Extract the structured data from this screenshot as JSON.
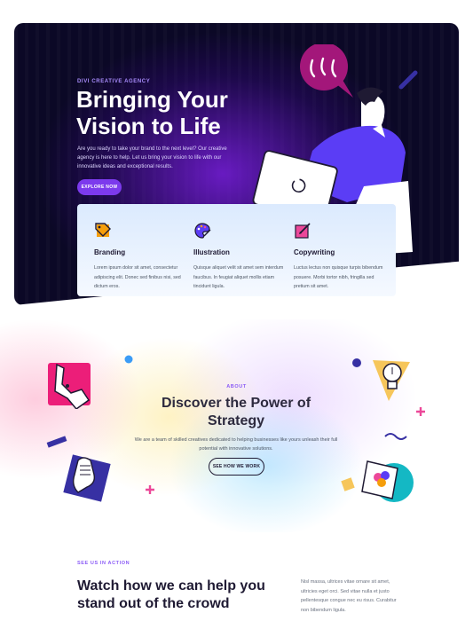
{
  "hero": {
    "eyebrow": "DIVI CREATIVE AGENCY",
    "title": "Bringing Your Vision to Life",
    "description": "Are you ready to take your brand to the next level? Our creative agency is here to help. Let us bring your vision to life with our innovative ideas and exceptional results.",
    "button_label": "EXPLORE NOW"
  },
  "features": [
    {
      "icon": "branding-tag-icon",
      "title": "Branding",
      "text": "Lorem ipsum dolor sit amet, consectetur adipiscing elit. Donec sed finibus nisi, sed dictum eros."
    },
    {
      "icon": "palette-icon",
      "title": "Illustration",
      "text": "Quisque aliquet velit sit amet sem interdum faucibus. In feugiat aliquet mollis etiam tincidunt ligula."
    },
    {
      "icon": "edit-pen-icon",
      "title": "Copywriting",
      "text": "Luctus lectus non quisque turpis bibendum posuere. Morbi tortor nibh, fringilla sed pretium sit amet."
    }
  ],
  "about": {
    "eyebrow": "ABOUT",
    "title": "Discover the Power of Strategy",
    "description": "We are a team of skilled creatives dedicated to helping businesses like yours unleash their full potential with innovative solutions.",
    "button_label": "SEE HOW WE WORK"
  },
  "action": {
    "eyebrow": "SEE US IN ACTION",
    "title": "Watch how we can help you stand out of the crowd",
    "text": "Nisl massa, ultrices vitae ornare sit amet, ultricies eget orci. Sed vitae nulla et justo pellentesque congue nec eu risus. Curabitur non bibendum ligula."
  },
  "colors": {
    "hero_bg": "#0b0826",
    "accent_purple": "#7c3aed",
    "accent_pink": "#ec4899",
    "accent_blue": "#3b82f6"
  }
}
